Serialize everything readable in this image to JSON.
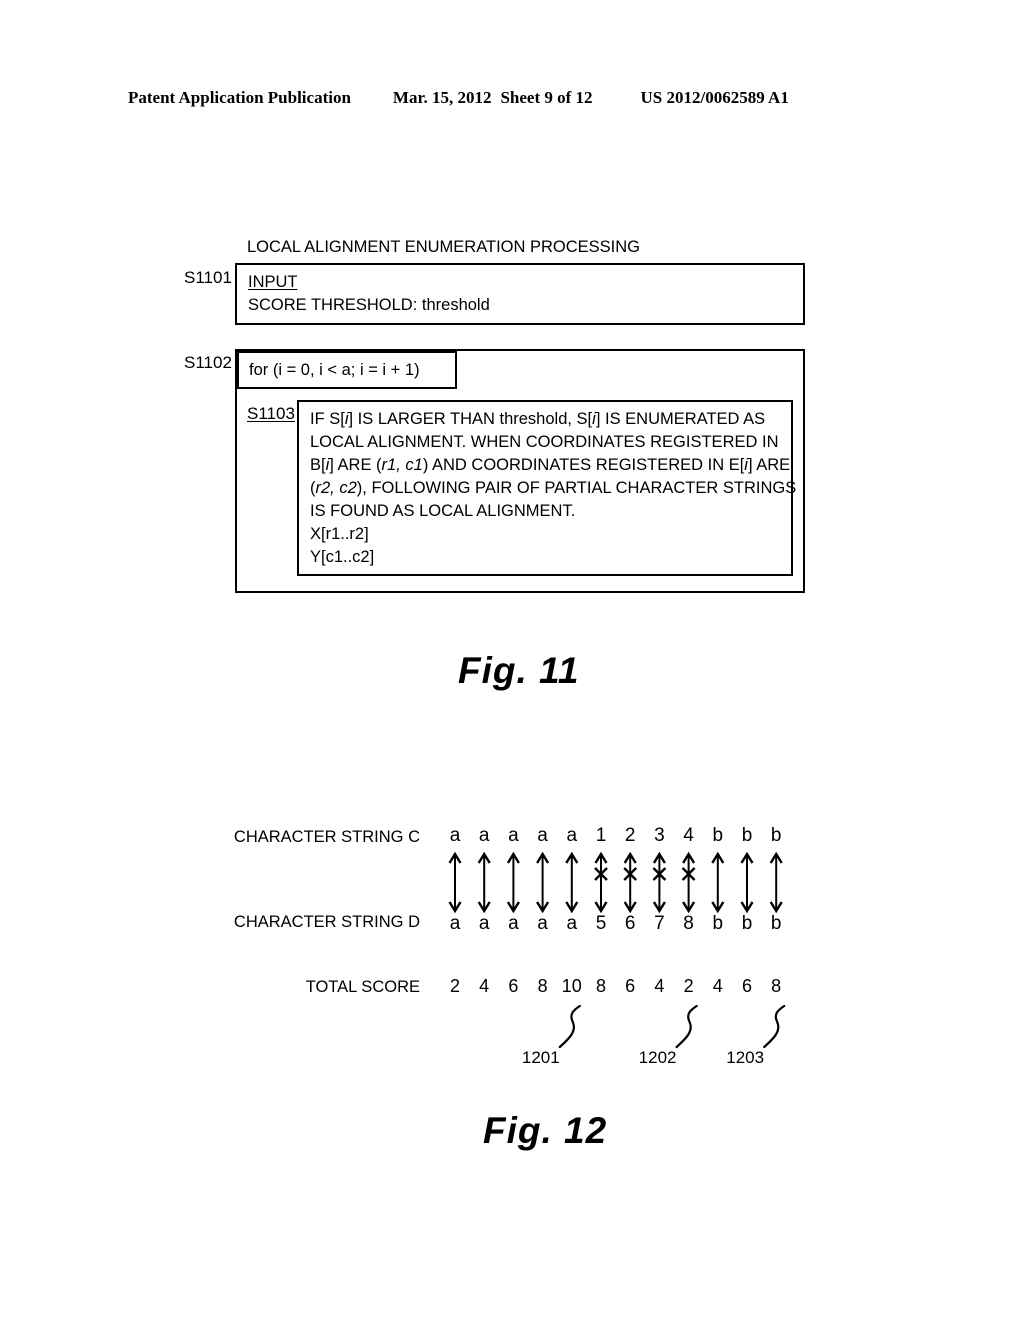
{
  "header": {
    "publication": "Patent Application Publication",
    "date": "Mar. 15, 2012",
    "sheet": "Sheet 9 of 12",
    "publication_number": "US 2012/0062589 A1"
  },
  "figure11": {
    "caption": "Fig. 11",
    "title": "LOCAL ALIGNMENT ENUMERATION PROCESSING",
    "steps": {
      "s1101": {
        "tag": "S1101",
        "line1": "INPUT",
        "line2": "SCORE THRESHOLD: threshold"
      },
      "s1102": {
        "tag": "S1102",
        "for_statement": "for (i = 0, i < a; i = i + 1)"
      },
      "s1103": {
        "tag": "S1103",
        "lines": [
          "IF S[i] IS LARGER THAN threshold, S[i] IS ENUMERATED AS",
          "LOCAL ALIGNMENT.  WHEN COORDINATES REGISTERED IN",
          "B[i] ARE (r1, c1) AND COORDINATES REGISTERED IN E[i] ARE",
          "(r2, c2), FOLLOWING PAIR OF PARTIAL CHARACTER STRINGS",
          "IS FOUND AS LOCAL ALIGNMENT.",
          "X[r1..r2]",
          "Y[c1..c2]"
        ]
      }
    }
  },
  "figure12": {
    "caption": "Fig. 12",
    "labels": {
      "string_c": "CHARACTER STRING C",
      "string_d": "CHARACTER STRING D",
      "total_score": "TOTAL SCORE"
    },
    "string_c": [
      "a",
      "a",
      "a",
      "a",
      "a",
      "1",
      "2",
      "3",
      "4",
      "b",
      "b",
      "b"
    ],
    "string_d": [
      "a",
      "a",
      "a",
      "a",
      "a",
      "5",
      "6",
      "7",
      "8",
      "b",
      "b",
      "b"
    ],
    "total_score": [
      "2",
      "4",
      "6",
      "8",
      "10",
      "8",
      "6",
      "4",
      "2",
      "4",
      "6",
      "8"
    ],
    "mismatch_columns": [
      5,
      6,
      7,
      8
    ],
    "callouts": [
      {
        "label": "1201",
        "column": 4
      },
      {
        "label": "1202",
        "column": 8
      },
      {
        "label": "1203",
        "column": 11
      }
    ]
  }
}
